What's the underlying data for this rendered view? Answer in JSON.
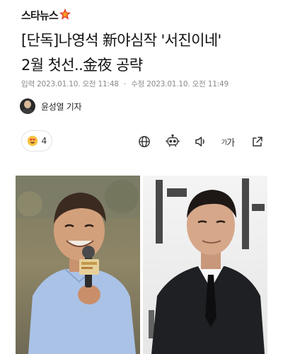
{
  "header": {
    "logo_text": "스타뉴스"
  },
  "article": {
    "headline_line1": "[단독]나영석 新야심작 '서진이네'",
    "headline_line2": "2월 첫선..金夜 공략",
    "input_label": "입력",
    "input_time": "2023.01.10. 오전 11:48",
    "modified_label": "수정",
    "modified_time": "2023.01.10. 오전 11:49",
    "reporter": "윤성열 기자"
  },
  "reactions": {
    "count": "4",
    "emoji": "heart-eyes-emoji"
  },
  "toolbar": {
    "font_small": "가",
    "font_large": "가",
    "icons": [
      "globe-icon",
      "robot-icon",
      "speaker-icon",
      "font-size-icon",
      "share-icon"
    ]
  },
  "colors": {
    "logo_star": "#e8392f",
    "meta_text": "#8a8a8a",
    "text": "#111111"
  }
}
